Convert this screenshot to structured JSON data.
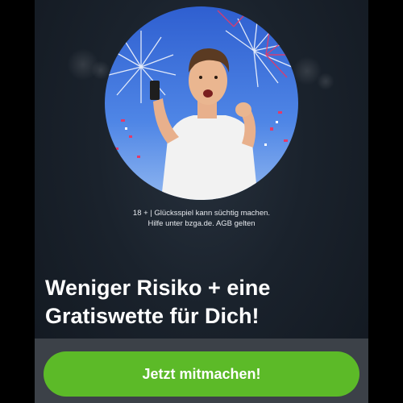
{
  "colors": {
    "panel_background": "#1a222c",
    "bottom_strip": "#3c4148",
    "cta_background": "#5cba28",
    "text": "#ffffff"
  },
  "hero": {
    "image": "man-celebrating-with-phone-fireworks-illustration"
  },
  "disclaimer": {
    "line1": "18 + | Glücksspiel kann süchtig machen.",
    "line2": "Hilfe unter bzga.de. AGB gelten"
  },
  "headline": {
    "line1": "Weniger Risiko + eine",
    "line2": "Gratiswette für Dich!"
  },
  "cta": {
    "label": "Jetzt mitmachen!"
  }
}
